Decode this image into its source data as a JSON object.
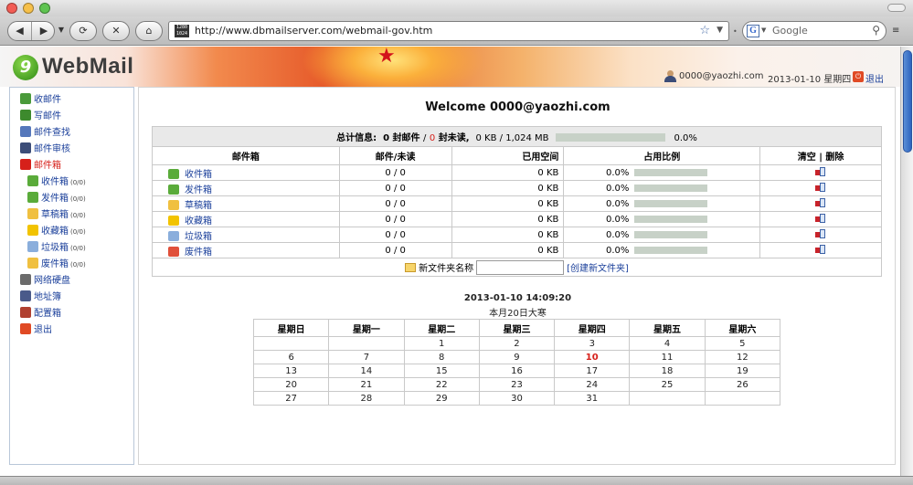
{
  "browser": {
    "url": "http://www.dbmailserver.com/webmail-gov.htm",
    "search_placeholder": "Google",
    "url_favicon_text": "1280\n1024"
  },
  "header": {
    "logo_text": "WebMail",
    "user_email": "0000@yaozhi.com",
    "date": "2013-01-10 星期四",
    "logout": "退出"
  },
  "sidebar": {
    "items": [
      {
        "label": "收邮件",
        "icon": "receive-mail-icon",
        "color": "#4a9a3a"
      },
      {
        "label": "写邮件",
        "icon": "compose-mail-icon",
        "color": "#3d8a2d"
      },
      {
        "label": "邮件查找",
        "icon": "search-mail-icon",
        "color": "#5577bb"
      },
      {
        "label": "邮件审核",
        "icon": "audit-mail-icon",
        "color": "#3c4d78"
      },
      {
        "label": "邮件箱",
        "icon": "mailbox-home-icon",
        "color": "#d6201a",
        "active": true
      },
      {
        "label": "收件箱",
        "count": "(0/0)",
        "icon": "inbox-icon",
        "color": "#5aab3a"
      },
      {
        "label": "发件箱",
        "count": "(0/0)",
        "icon": "outbox-icon",
        "color": "#5aab3a"
      },
      {
        "label": "草稿箱",
        "count": "(0/0)",
        "icon": "drafts-icon",
        "color": "#f0c040"
      },
      {
        "label": "收藏箱",
        "count": "(0/0)",
        "icon": "favorites-icon",
        "color": "#f2c300"
      },
      {
        "label": "垃圾箱",
        "count": "(0/0)",
        "icon": "trash-icon",
        "color": "#8aaedc"
      },
      {
        "label": "废件箱",
        "count": "(0/0)",
        "icon": "junk-icon",
        "color": "#f0c040"
      },
      {
        "label": "网络硬盘",
        "icon": "network-disk-icon",
        "color": "#6b6b6b"
      },
      {
        "label": "地址簿",
        "icon": "address-book-icon",
        "color": "#4a5a8a"
      },
      {
        "label": "配置箱",
        "icon": "settings-tools-icon",
        "color": "#b04030"
      },
      {
        "label": "退出",
        "icon": "exit-icon",
        "color": "#e04a24"
      }
    ]
  },
  "main": {
    "welcome": "Welcome 0000@yaozhi.com",
    "summary": {
      "label": "总计信息:",
      "mail_count": "0 封邮件",
      "sep": "/",
      "unread": "0",
      "unread_label": "封未读,",
      "size": "0 KB / 1,024 MB",
      "percent": "0.0%",
      "usage_fraction": 0.0
    },
    "headers": [
      "邮件箱",
      "邮件/未读",
      "已用空间",
      "占用比例",
      "清空 | 删除"
    ],
    "mailboxes": [
      {
        "name": "收件箱",
        "icon_color": "#5aab3a",
        "messages": "0 / 0",
        "used": "0 KB",
        "ratio": "0.0%",
        "action": "clear"
      },
      {
        "name": "发件箱",
        "icon_color": "#5aab3a",
        "messages": "0 / 0",
        "used": "0 KB",
        "ratio": "0.0%",
        "action": "clear"
      },
      {
        "name": "草稿箱",
        "icon_color": "#f0c040",
        "messages": "0 / 0",
        "used": "0 KB",
        "ratio": "0.0%",
        "action": "clear"
      },
      {
        "name": "收藏箱",
        "icon_color": "#f2c300",
        "messages": "0 / 0",
        "used": "0 KB",
        "ratio": "0.0%",
        "action": "clear"
      },
      {
        "name": "垃圾箱",
        "icon_color": "#8aaedc",
        "messages": "0 / 0",
        "used": "0 KB",
        "ratio": "0.0%",
        "action": "clear"
      },
      {
        "name": "废件箱",
        "icon_color": "#e0503a",
        "messages": "0 / 0",
        "used": "0 KB",
        "ratio": "0.0%",
        "action": "delete"
      }
    ],
    "new_folder": {
      "label": "新文件夹名称",
      "input_value": "",
      "create_link": "[创建新文件夹]"
    },
    "clock": "2013-01-10 14:09:20",
    "lunar": "本月20日大寒",
    "calendar": {
      "weekdays": [
        "星期日",
        "星期一",
        "星期二",
        "星期三",
        "星期四",
        "星期五",
        "星期六"
      ],
      "weeks": [
        [
          "",
          "",
          "1",
          "2",
          "3",
          "4",
          "5"
        ],
        [
          "6",
          "7",
          "8",
          "9",
          "10",
          "11",
          "12"
        ],
        [
          "13",
          "14",
          "15",
          "16",
          "17",
          "18",
          "19"
        ],
        [
          "20",
          "21",
          "22",
          "23",
          "24",
          "25",
          "26"
        ],
        [
          "27",
          "28",
          "29",
          "30",
          "31",
          "",
          ""
        ]
      ],
      "today": "10"
    }
  }
}
